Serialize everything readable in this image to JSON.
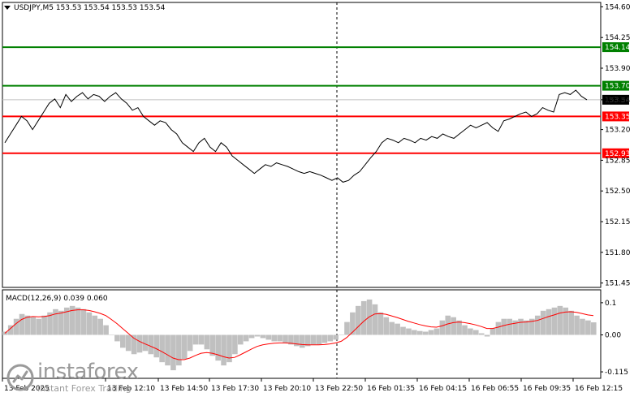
{
  "chart_header": {
    "title": "USDJPY,M5  153.53 153.54 153.53 153.54"
  },
  "macd": {
    "label": "MACD(12,26,9) 0.039 0.060",
    "axis_labels": [
      "0.1",
      "0.00",
      "-0.115"
    ],
    "axis_values": [
      0.1,
      0.0,
      -0.115
    ]
  },
  "logo": {
    "name": "instaforex",
    "tagline": "Instant Forex Trading"
  },
  "colors": {
    "background": "#ffffff",
    "price_line": "#000000",
    "support_lines": "#ff0000",
    "resistance_lines": "#008000",
    "histogram": "#c0c0c0",
    "signal": "#ff0000",
    "price_tag_bg": "#000000"
  },
  "chart_data": {
    "type": "line",
    "symbol": "USDJPY",
    "timeframe": "M5",
    "ylim": [
      151.4,
      154.65
    ],
    "y_ticks": [
      "154.60",
      "154.25",
      "153.90",
      "153.54",
      "153.20",
      "152.85",
      "152.50",
      "152.15",
      "151.80",
      "151.45"
    ],
    "y_tick_values": [
      154.6,
      154.25,
      153.9,
      153.54,
      153.2,
      152.85,
      152.5,
      152.15,
      151.8,
      151.45
    ],
    "x_ticks": [
      "13 Feb 2025",
      "13 Feb 12:10",
      "13 Feb 14:50",
      "13 Feb 17:30",
      "13 Feb 20:10",
      "13 Feb 22:50",
      "16 Feb 01:35",
      "16 Feb 04:15",
      "16 Feb 06:55",
      "16 Feb 09:35",
      "16 Feb 12:15"
    ],
    "levels": [
      {
        "label": "154.14",
        "value": 154.14,
        "color": "#008000"
      },
      {
        "label": "153.70",
        "value": 153.7,
        "color": "#008000"
      },
      {
        "label": "153.35",
        "value": 153.35,
        "color": "#ff0000"
      },
      {
        "label": "152.93",
        "value": 152.93,
        "color": "#ff0000"
      }
    ],
    "current_price": {
      "label": "153.54",
      "value": 153.54
    },
    "close_series": [
      153.05,
      153.15,
      153.25,
      153.35,
      153.3,
      153.2,
      153.3,
      153.4,
      153.5,
      153.55,
      153.45,
      153.6,
      153.52,
      153.58,
      153.62,
      153.55,
      153.6,
      153.58,
      153.52,
      153.58,
      153.62,
      153.55,
      153.5,
      153.42,
      153.45,
      153.35,
      153.3,
      153.25,
      153.3,
      153.28,
      153.2,
      153.15,
      153.05,
      153.0,
      152.95,
      153.05,
      153.1,
      153.0,
      152.95,
      153.05,
      153.0,
      152.9,
      152.85,
      152.8,
      152.75,
      152.7,
      152.75,
      152.8,
      152.78,
      152.82,
      152.8,
      152.78,
      152.75,
      152.72,
      152.7,
      152.72,
      152.7,
      152.68,
      152.65,
      152.62,
      152.65,
      152.6,
      152.62,
      152.68,
      152.72,
      152.8,
      152.88,
      152.95,
      153.05,
      153.1,
      153.08,
      153.05,
      153.1,
      153.08,
      153.05,
      153.1,
      153.08,
      153.12,
      153.1,
      153.15,
      153.12,
      153.1,
      153.15,
      153.2,
      153.25,
      153.22,
      153.25,
      153.28,
      153.22,
      153.18,
      153.3,
      153.32,
      153.35,
      153.38,
      153.4,
      153.35,
      153.38,
      153.45,
      153.42,
      153.4,
      153.6,
      153.62,
      153.6,
      153.65,
      153.58,
      153.54
    ],
    "macd_histogram": [
      0.01,
      0.03,
      0.05,
      0.065,
      0.06,
      0.055,
      0.05,
      0.06,
      0.07,
      0.08,
      0.075,
      0.085,
      0.09,
      0.085,
      0.08,
      0.07,
      0.06,
      0.05,
      0.03,
      0.0,
      -0.02,
      -0.04,
      -0.05,
      -0.06,
      -0.055,
      -0.05,
      -0.06,
      -0.07,
      -0.085,
      -0.095,
      -0.11,
      -0.095,
      -0.075,
      -0.05,
      -0.03,
      -0.03,
      -0.045,
      -0.065,
      -0.08,
      -0.095,
      -0.085,
      -0.06,
      -0.03,
      -0.02,
      -0.01,
      -0.005,
      -0.01,
      -0.015,
      -0.02,
      -0.02,
      -0.025,
      -0.03,
      -0.035,
      -0.04,
      -0.035,
      -0.03,
      -0.03,
      -0.025,
      -0.02,
      -0.015,
      0.0,
      0.04,
      0.07,
      0.09,
      0.105,
      0.11,
      0.095,
      0.07,
      0.055,
      0.04,
      0.035,
      0.025,
      0.02,
      0.015,
      0.012,
      0.01,
      0.015,
      0.02,
      0.045,
      0.06,
      0.055,
      0.045,
      0.03,
      0.02,
      0.015,
      0.005,
      -0.005,
      0.02,
      0.04,
      0.05,
      0.05,
      0.045,
      0.05,
      0.045,
      0.05,
      0.06,
      0.075,
      0.08,
      0.085,
      0.09,
      0.085,
      0.075,
      0.06,
      0.05,
      0.045,
      0.039
    ],
    "macd_signal": [
      0.005,
      0.02,
      0.035,
      0.048,
      0.055,
      0.057,
      0.056,
      0.057,
      0.06,
      0.065,
      0.068,
      0.072,
      0.076,
      0.078,
      0.078,
      0.076,
      0.072,
      0.067,
      0.06,
      0.048,
      0.035,
      0.02,
      0.005,
      -0.01,
      -0.02,
      -0.028,
      -0.035,
      -0.043,
      -0.052,
      -0.062,
      -0.072,
      -0.077,
      -0.077,
      -0.072,
      -0.064,
      -0.057,
      -0.055,
      -0.057,
      -0.062,
      -0.068,
      -0.072,
      -0.07,
      -0.062,
      -0.053,
      -0.044,
      -0.036,
      -0.031,
      -0.028,
      -0.026,
      -0.025,
      -0.025,
      -0.026,
      -0.028,
      -0.03,
      -0.031,
      -0.031,
      -0.031,
      -0.03,
      -0.028,
      -0.025,
      -0.02,
      -0.008,
      0.008,
      0.025,
      0.042,
      0.056,
      0.065,
      0.066,
      0.064,
      0.059,
      0.054,
      0.048,
      0.042,
      0.037,
      0.032,
      0.028,
      0.025,
      0.024,
      0.028,
      0.034,
      0.038,
      0.04,
      0.038,
      0.035,
      0.031,
      0.026,
      0.02,
      0.02,
      0.024,
      0.029,
      0.033,
      0.036,
      0.039,
      0.04,
      0.042,
      0.045,
      0.051,
      0.057,
      0.062,
      0.068,
      0.071,
      0.072,
      0.07,
      0.066,
      0.062,
      0.06
    ]
  }
}
